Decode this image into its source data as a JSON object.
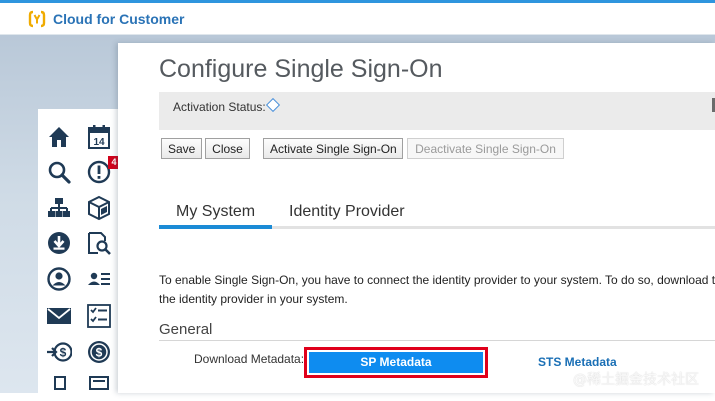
{
  "app": {
    "title": "Cloud for Customer",
    "colors": {
      "accent": "#2a73b6",
      "topline": "#2f95de",
      "highlight": "#e0001b",
      "primary_button": "#0e8cf0"
    }
  },
  "rail": {
    "items": [
      {
        "icon": "home-icon"
      },
      {
        "icon": "calendar-icon",
        "label": "14"
      },
      {
        "icon": "search-icon"
      },
      {
        "icon": "alert-icon",
        "badge": "4"
      },
      {
        "icon": "org-chart-icon"
      },
      {
        "icon": "cube-icon"
      },
      {
        "icon": "download-icon"
      },
      {
        "icon": "search-document-icon"
      },
      {
        "icon": "account-icon"
      },
      {
        "icon": "contacts-list-icon"
      },
      {
        "icon": "email-icon"
      },
      {
        "icon": "checklist-icon"
      },
      {
        "icon": "payment-arrow-icon"
      },
      {
        "icon": "currency-icon"
      }
    ]
  },
  "page": {
    "title": "Configure Single Sign-On",
    "activation_status_label": "Activation Status:",
    "toolbar": {
      "save_label": "Save",
      "close_label": "Close",
      "activate_label": "Activate Single Sign-On",
      "deactivate_label": "Deactivate Single Sign-On"
    },
    "tabs": [
      {
        "label": "My System",
        "active": true
      },
      {
        "label": "Identity Provider",
        "active": false
      }
    ],
    "intro_line1": "To enable Single Sign-On, you have to connect the identity provider to your system. To do so, download t",
    "intro_line2": "the identity provider in your system.",
    "general": {
      "title": "General",
      "download_label": "Download Metadata:",
      "sp_metadata_label": "SP Metadata",
      "sts_metadata_label": "STS Metadata"
    }
  },
  "watermark": "@稀土掘金技术社区"
}
